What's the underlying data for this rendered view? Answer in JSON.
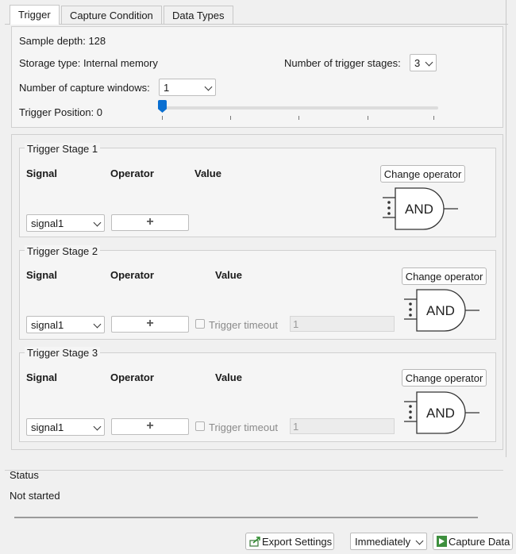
{
  "tabs": [
    "Trigger",
    "Capture Condition",
    "Data Types"
  ],
  "info": {
    "sample_depth": "Sample depth: 128",
    "storage_type": "Storage type: Internal memory",
    "trigger_stages_label": "Number of trigger stages:",
    "trigger_stages_value": "3",
    "capture_windows_label": "Number of capture windows:",
    "capture_windows_value": "1",
    "trigger_position": "Trigger Position: 0",
    "slider_fraction": 0.0
  },
  "stages": [
    {
      "title": "Trigger Stage 1",
      "signal_header": "Signal",
      "operator_header": "Operator",
      "value_header": "Value",
      "signal": "signal1",
      "change_operator": "Change operator",
      "gate": "AND"
    },
    {
      "title": "Trigger Stage 2",
      "signal_header": "Signal",
      "operator_header": "Operator",
      "value_header": "Value",
      "signal": "signal1",
      "timeout_label": "Trigger timeout",
      "timeout_value": "1",
      "change_operator": "Change operator",
      "gate": "AND"
    },
    {
      "title": "Trigger Stage 3",
      "signal_header": "Signal",
      "operator_header": "Operator",
      "value_header": "Value",
      "signal": "signal1",
      "timeout_label": "Trigger timeout",
      "timeout_value": "1",
      "change_operator": "Change operator",
      "gate": "AND"
    }
  ],
  "status": {
    "title": "Status",
    "text": "Not started"
  },
  "footer": {
    "export_label": "Export Settings",
    "mode_value": "Immediately",
    "capture_label": "Capture Data"
  },
  "icons": {
    "add": "plus-icon",
    "export": "export-icon",
    "capture": "play-icon",
    "gate": "and-gate-icon"
  }
}
